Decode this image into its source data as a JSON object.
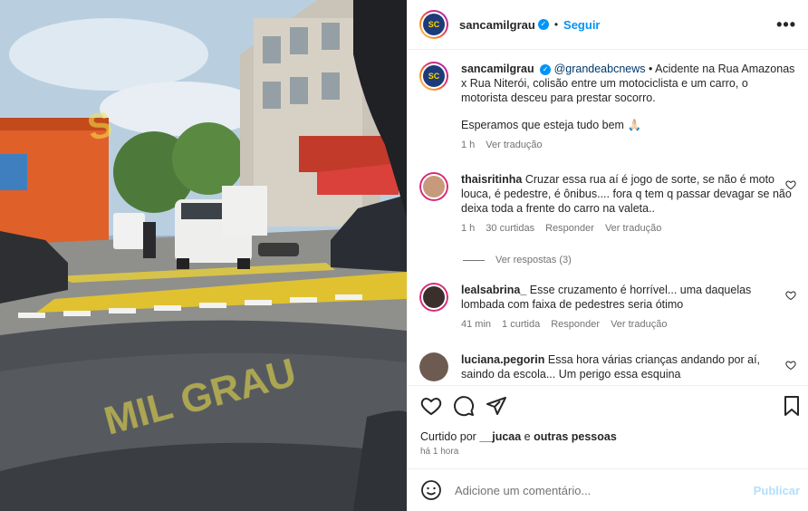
{
  "post": {
    "username": "sancamilgrau",
    "follow_label": "Seguir",
    "more_label": "•••",
    "photo_watermark": "MIL GRAU"
  },
  "caption": {
    "username": "sancamilgrau",
    "mention": "@grandeabcnews",
    "text": " • Acidente na Rua Amazonas x Rua Niterói, colisão entre um motociclista e um carro, o motorista desceu para prestar socorro.",
    "text2": "Esperamos que esteja tudo bem 🙏🏻",
    "time": "1 h",
    "translate": "Ver tradução"
  },
  "comments": [
    {
      "username": "thaisritinha",
      "text": " Cruzar essa rua aí é jogo de sorte, se não é moto louca, é pedestre, é ônibus.... fora q tem q passar devagar se não deixa toda a frente do carro na valeta..",
      "time": "1 h",
      "likes": "30 curtidas",
      "reply": "Responder",
      "translate": "Ver tradução",
      "replies": "Ver respostas (3)",
      "color": "#c79a7c"
    },
    {
      "username": "lealsabrina_",
      "text": " Esse cruzamento é horrível... uma daquelas lombada com faixa de pedestres seria ótimo",
      "time": "41 min",
      "likes": "1 curtida",
      "reply": "Responder",
      "translate": "Ver tradução",
      "color": "#3a2f2b"
    },
    {
      "username": "luciana.pegorin",
      "text": " Essa hora várias crianças andando por aí, saindo da escola... Um perigo essa esquina",
      "color": "#6d5a50"
    }
  ],
  "likes": {
    "prefix": "Curtido por ",
    "user": "__jucaa",
    "middle": " e ",
    "others": "outras pessoas"
  },
  "timestamp": "há 1 hora",
  "add_comment": {
    "placeholder": "Adicione um comentário...",
    "publish": "Publicar"
  },
  "colors": {
    "accent": "#0095f6",
    "text": "#262626",
    "muted": "#737373"
  }
}
